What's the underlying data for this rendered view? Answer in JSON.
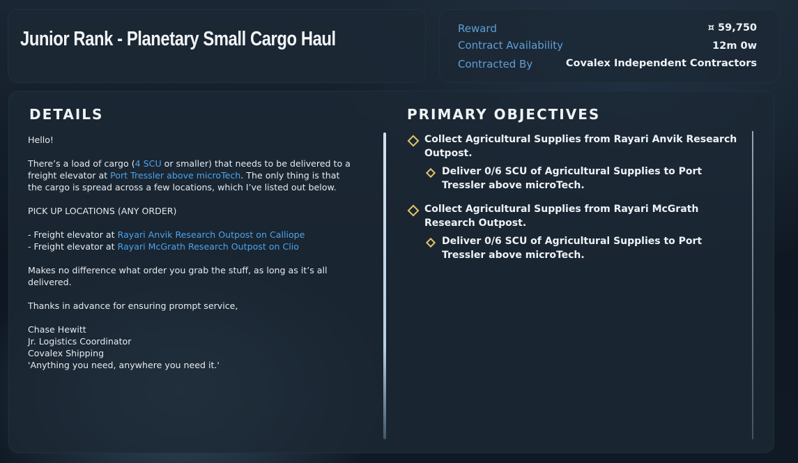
{
  "contract": {
    "title": "Junior Rank - Planetary Small Cargo Haul"
  },
  "info": {
    "reward_label": "Reward",
    "reward_value": "¤ 59,750",
    "availability_label": "Contract Availability",
    "availability_value": "12m 0w",
    "contracted_by_label": "Contracted By",
    "contracted_by_value": "Covalex Independent Contractors"
  },
  "details": {
    "heading": "DETAILS",
    "greeting": "Hello!",
    "para1_a": "There’s a load of cargo (",
    "para1_hl1": "4 SCU",
    "para1_b": " or smaller) that needs to be delivered to a freight elevator at ",
    "para1_hl2": "Port Tressler above microTech",
    "para1_c": ". The only thing is that the cargo is spread across a few locations, which I’ve listed out below.",
    "pickup_heading": "PICK UP LOCATIONS (ANY ORDER)",
    "pickup1_prefix": "- Freight elevator at ",
    "pickup1_loc": "Rayari Anvik Research Outpost on Calliope",
    "pickup2_prefix": "- Freight elevator at ",
    "pickup2_loc": "Rayari McGrath Research Outpost on Clio",
    "para2": "Makes no difference what order you grab the stuff, as long as it’s all delivered.",
    "para3": "Thanks in advance for ensuring prompt service,",
    "sig_name": "Chase Hewitt",
    "sig_title": "Jr. Logistics Coordinator",
    "sig_company": "Covalex Shipping",
    "sig_motto": "'Anything you need, anywhere you need it.'"
  },
  "objectives": {
    "heading": "PRIMARY OBJECTIVES",
    "items": [
      {
        "text": "Collect Agricultural Supplies from Rayari Anvik Research Outpost."
      },
      {
        "text": "Deliver 0/6 SCU of Agricultural Supplies to Port Tressler above microTech."
      },
      {
        "text": "Collect Agricultural Supplies from Rayari McGrath Research Outpost."
      },
      {
        "text": "Deliver 0/6 SCU of Agricultural Supplies to Port Tressler above microTech."
      }
    ]
  },
  "colors": {
    "accent_blue": "#4ea3ea",
    "label_blue": "#5f9fd6",
    "objective_marker": "#e3c56a"
  },
  "icons": {
    "objective_marker": "diamond-outline-icon",
    "sub_objective_marker": "small-diamond-outline-icon"
  }
}
